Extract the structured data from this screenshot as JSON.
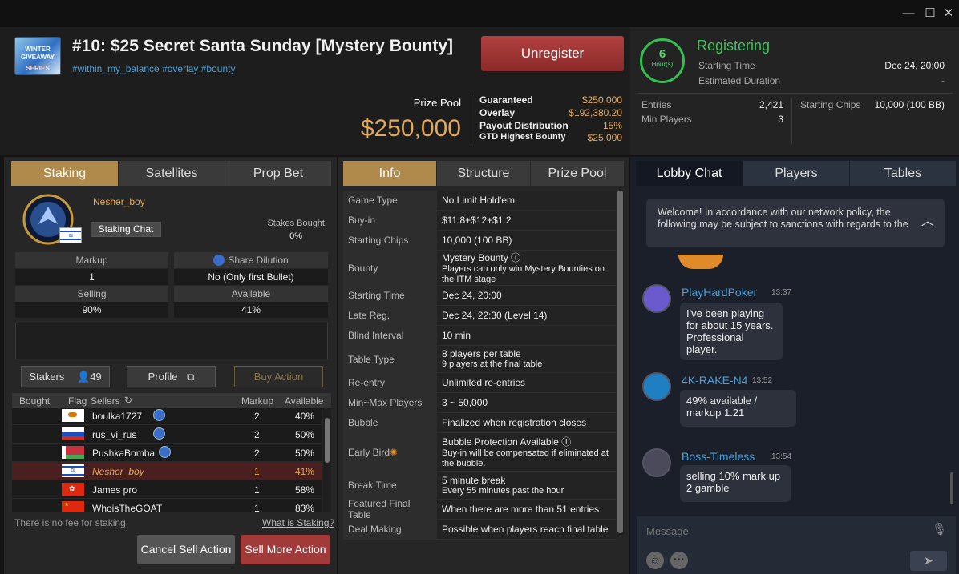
{
  "window": {
    "minimize": "—",
    "maximize": "☐",
    "close": "✕"
  },
  "header": {
    "logo_top": "WINTER",
    "logo_mid": "GIVEAWAY",
    "logo_bottom": "SERIES",
    "title": "#10: $25 Secret Santa Sunday [Mystery Bounty]",
    "tags": "#within_my_balance #overlay #bounty",
    "unregister": "Unregister",
    "prize_pool_label": "Prize Pool",
    "prize_pool_value": "$250,000",
    "prize_rows": [
      {
        "label": "Guaranteed",
        "value": "$250,000"
      },
      {
        "label": "Overlay",
        "value": "$192,380.20"
      },
      {
        "label": "Payout Distribution",
        "value": "15%"
      },
      {
        "label": "GTD Highest Bounty",
        "value": "$25,000"
      }
    ]
  },
  "status": {
    "ring_value": "6",
    "ring_unit": "Hour(s)",
    "state": "Registering",
    "starting_time_label": "Starting Time",
    "starting_time": "Dec 24, 20:00",
    "duration_label": "Estimated Duration",
    "duration": "-",
    "entries_label": "Entries",
    "entries": "2,421",
    "min_players_label": "Min Players",
    "min_players": "3",
    "starting_chips_label": "Starting Chips",
    "starting_chips": "10,000 (100 BB)"
  },
  "left": {
    "tabs": [
      "Staking",
      "Satellites",
      "Prop Bet"
    ],
    "user": "Nesher_boy",
    "staking_chat": "Staking Chat",
    "stakes_bought_label": "Stakes Bought",
    "stakes_bought": "0%",
    "markup_label": "Markup",
    "markup": "1",
    "dilution_label": "Share Dilution",
    "dilution": "No (Only first Bullet)",
    "selling_label": "Selling",
    "selling": "90%",
    "available_label": "Available",
    "available": "41%",
    "stakers_label": "Stakers",
    "stakers_count": "49",
    "profile": "Profile",
    "buy_action": "Buy Action",
    "columns": [
      "Bought",
      "Flag",
      "Sellers",
      "Markup",
      "Available"
    ],
    "rows": [
      {
        "name": "boulka1727",
        "markup": "2",
        "avail": "40%",
        "flag": "cyprus",
        "badge": true,
        "me": false
      },
      {
        "name": "rus_vi_rus",
        "markup": "2",
        "avail": "50%",
        "flag": "russia",
        "badge": true,
        "me": false
      },
      {
        "name": "PushkaBomba",
        "markup": "2",
        "avail": "50%",
        "flag": "belarus",
        "badge": true,
        "me": false
      },
      {
        "name": "Nesher_boy",
        "markup": "1",
        "avail": "41%",
        "flag": "israel",
        "badge": false,
        "me": true
      },
      {
        "name": "James pro",
        "markup": "1",
        "avail": "58%",
        "flag": "hongkong",
        "badge": false,
        "me": false
      },
      {
        "name": "WhoisTheGOAT",
        "markup": "1",
        "avail": "83%",
        "flag": "china",
        "badge": false,
        "me": false
      }
    ],
    "fee_note": "There is no fee for staking.",
    "what_is": "What is Staking?",
    "cancel": "Cancel Sell Action",
    "sell_more": "Sell More Action"
  },
  "info": {
    "tabs": [
      "Info",
      "Structure",
      "Prize Pool"
    ],
    "rows": [
      {
        "k": "Game Type",
        "v": "No Limit Hold'em"
      },
      {
        "k": "Buy-in",
        "v": "$11.8+$12+$1.2"
      },
      {
        "k": "Starting Chips",
        "v": "10,000 (100 BB)"
      },
      {
        "k": "Bounty",
        "v": "Mystery Bounty",
        "v2": "Players can only win Mystery Bounties on the ITM stage"
      },
      {
        "k": "Starting Time",
        "v": "Dec 24, 20:00"
      },
      {
        "k": "Late Reg.",
        "v": "Dec 24, 22:30 (Level 14)"
      },
      {
        "k": "Blind Interval",
        "v": "10 min"
      },
      {
        "k": "Table Type",
        "v": "8 players per table",
        "v2": "9 players at the final table"
      },
      {
        "k": "Re-entry",
        "v": "Unlimited re-entries"
      },
      {
        "k": "Min~Max Players",
        "v": "3 ~ 50,000"
      },
      {
        "k": "Bubble",
        "v": "Finalized when registration closes"
      },
      {
        "k": "Early Bird",
        "v": "Bubble Protection Available",
        "v2": "Buy-in will be compensated if eliminated at the bubble."
      },
      {
        "k": "Break Time",
        "v": "5 minute break",
        "v2": "Every 55 minutes past the hour"
      },
      {
        "k": "Featured Final Table",
        "v": "When there are more than 51 entries"
      },
      {
        "k": "Deal Making",
        "v": "Possible when players reach final table"
      }
    ]
  },
  "chat": {
    "tabs": [
      "Lobby Chat",
      "Players",
      "Tables"
    ],
    "welcome": "Welcome! In accordance with our network policy, the following may be subject to sanctions with regards to the",
    "messages": [
      {
        "user": "PlayHardPoker",
        "time": "13:37",
        "text": "I've been playing for about 15 years. Professional player."
      },
      {
        "user": "4K-RAKE-N4",
        "time": "13:52",
        "text": "49% available / markup 1.21"
      },
      {
        "user": "Boss-Timeless",
        "time": "13:54",
        "text": "selling 10% mark up 2 gamble"
      }
    ],
    "placeholder": "Message"
  },
  "colors": {
    "accent": "#b08a4a",
    "gold": "#e3a95a",
    "green": "#3ec25a",
    "link": "#4aa0d8",
    "danger": "#a33a3a"
  }
}
